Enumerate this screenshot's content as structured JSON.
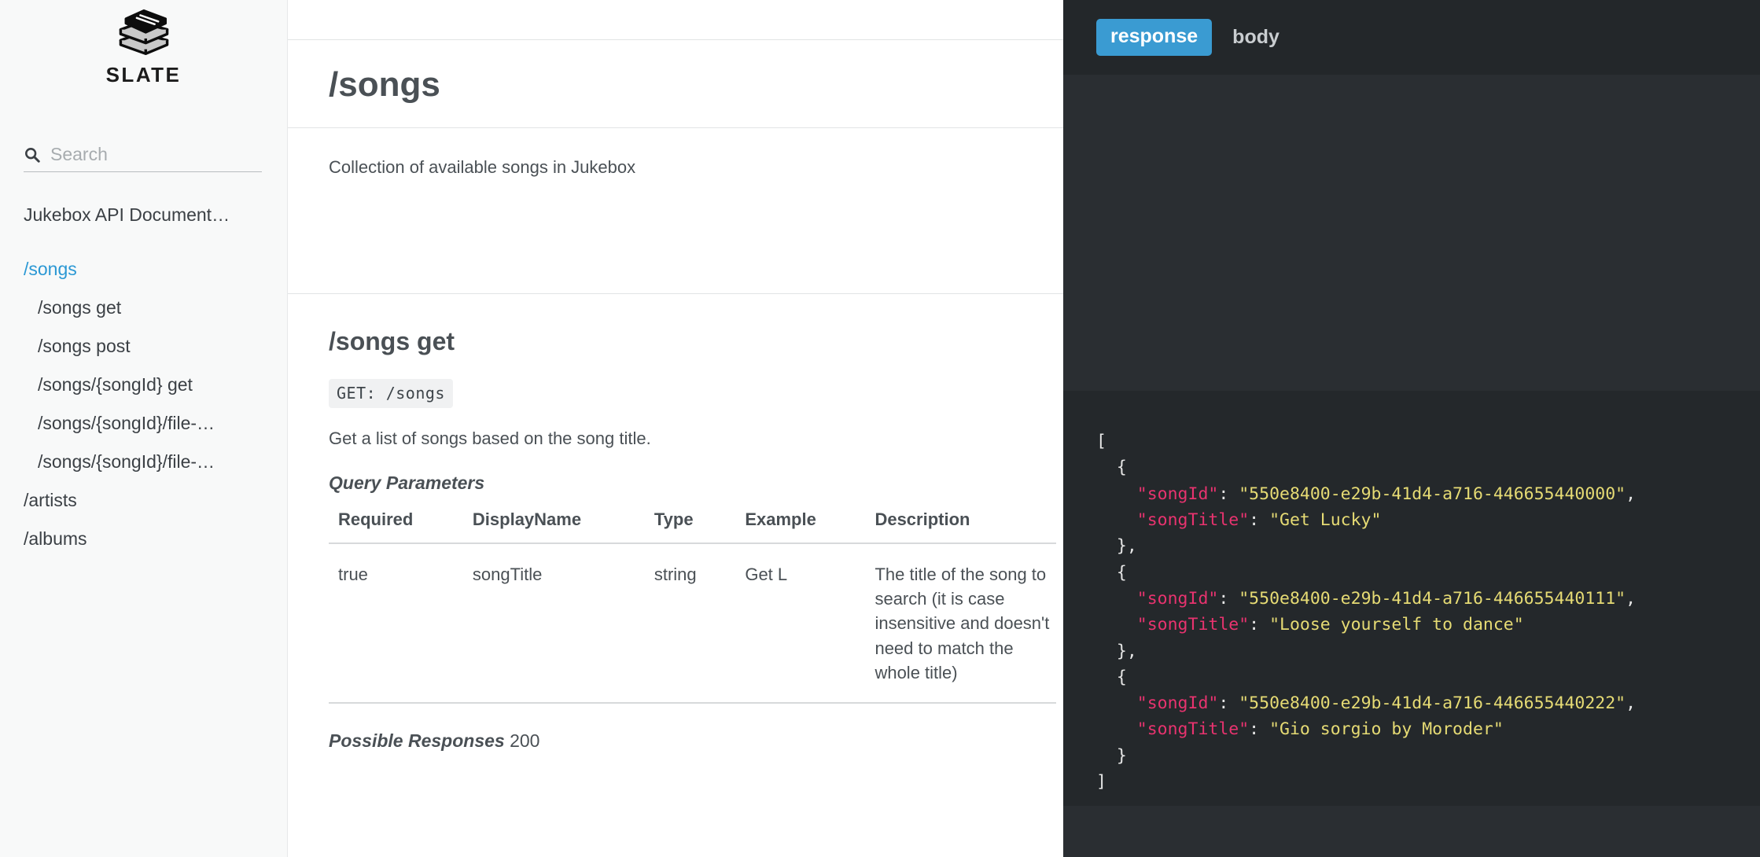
{
  "sidebar": {
    "logo_icon": "stacked-books-icon",
    "logo_text": "SLATE",
    "search": {
      "icon": "search-icon",
      "placeholder": "Search",
      "value": ""
    },
    "items": [
      {
        "label": "Jukebox API Document…",
        "level": 0,
        "active": false,
        "spaced": false
      },
      {
        "label": "/songs",
        "level": 0,
        "active": true,
        "spaced": true
      },
      {
        "label": "/songs get",
        "level": 1,
        "active": false,
        "spaced": false
      },
      {
        "label": "/songs post",
        "level": 1,
        "active": false,
        "spaced": false
      },
      {
        "label": "/songs/{songId} get",
        "level": 1,
        "active": false,
        "spaced": false
      },
      {
        "label": "/songs/{songId}/file-…",
        "level": 1,
        "active": false,
        "spaced": false
      },
      {
        "label": "/songs/{songId}/file-…",
        "level": 1,
        "active": false,
        "spaced": false
      },
      {
        "label": "/artists",
        "level": 0,
        "active": false,
        "spaced": false
      },
      {
        "label": "/albums",
        "level": 0,
        "active": false,
        "spaced": false
      }
    ]
  },
  "main": {
    "page_title": "/songs",
    "page_description": "Collection of available songs in Jukebox",
    "method_section": {
      "heading": "/songs get",
      "code_badge": "GET: /songs",
      "description": "Get a list of songs based on the song title.",
      "params_heading": "Query Parameters",
      "table": {
        "headers": [
          "Required",
          "DisplayName",
          "Type",
          "Example",
          "Description"
        ],
        "rows": [
          [
            "true",
            "songTitle",
            "string",
            "Get L",
            "The title of the song to search (it is case insensitive and doesn't need to match the whole title)"
          ]
        ]
      },
      "responses_label": "Possible Responses",
      "responses_code": "200"
    }
  },
  "panel": {
    "tabs": [
      {
        "label": "response",
        "active": true
      },
      {
        "label": "body",
        "active": false
      }
    ],
    "code_lines": [
      [
        {
          "t": "[",
          "c": "p"
        }
      ],
      [
        {
          "t": "  {",
          "c": "p"
        }
      ],
      [
        {
          "t": "    ",
          "c": "p"
        },
        {
          "t": "\"songId\"",
          "c": "k"
        },
        {
          "t": ": ",
          "c": "p"
        },
        {
          "t": "\"550e8400-e29b-41d4-a716-446655440000\"",
          "c": "s"
        },
        {
          "t": ",",
          "c": "p"
        }
      ],
      [
        {
          "t": "    ",
          "c": "p"
        },
        {
          "t": "\"songTitle\"",
          "c": "k"
        },
        {
          "t": ": ",
          "c": "p"
        },
        {
          "t": "\"Get Lucky\"",
          "c": "s"
        }
      ],
      [
        {
          "t": "  },",
          "c": "p"
        }
      ],
      [
        {
          "t": "  {",
          "c": "p"
        }
      ],
      [
        {
          "t": "    ",
          "c": "p"
        },
        {
          "t": "\"songId\"",
          "c": "k"
        },
        {
          "t": ": ",
          "c": "p"
        },
        {
          "t": "\"550e8400-e29b-41d4-a716-446655440111\"",
          "c": "s"
        },
        {
          "t": ",",
          "c": "p"
        }
      ],
      [
        {
          "t": "    ",
          "c": "p"
        },
        {
          "t": "\"songTitle\"",
          "c": "k"
        },
        {
          "t": ": ",
          "c": "p"
        },
        {
          "t": "\"Loose yourself to dance\"",
          "c": "s"
        }
      ],
      [
        {
          "t": "  },",
          "c": "p"
        }
      ],
      [
        {
          "t": "  {",
          "c": "p"
        }
      ],
      [
        {
          "t": "    ",
          "c": "p"
        },
        {
          "t": "\"songId\"",
          "c": "k"
        },
        {
          "t": ": ",
          "c": "p"
        },
        {
          "t": "\"550e8400-e29b-41d4-a716-446655440222\"",
          "c": "s"
        },
        {
          "t": ",",
          "c": "p"
        }
      ],
      [
        {
          "t": "    ",
          "c": "p"
        },
        {
          "t": "\"songTitle\"",
          "c": "k"
        },
        {
          "t": ": ",
          "c": "p"
        },
        {
          "t": "\"Gio sorgio by Moroder\"",
          "c": "s"
        }
      ],
      [
        {
          "t": "  }",
          "c": "p"
        }
      ],
      [
        {
          "t": "]",
          "c": "p"
        }
      ]
    ]
  },
  "colors": {
    "sidebar_bg": "#f8f9f9",
    "accent_blue": "#2b98d4",
    "tab_blue": "#3a9bd2",
    "panel_bg": "#2a2e32",
    "panel_header_bg": "#23272a",
    "code_bg": "#24282b",
    "text_dark": "#4a5055",
    "json_key": "#e8336f",
    "json_string": "#e6db74"
  }
}
